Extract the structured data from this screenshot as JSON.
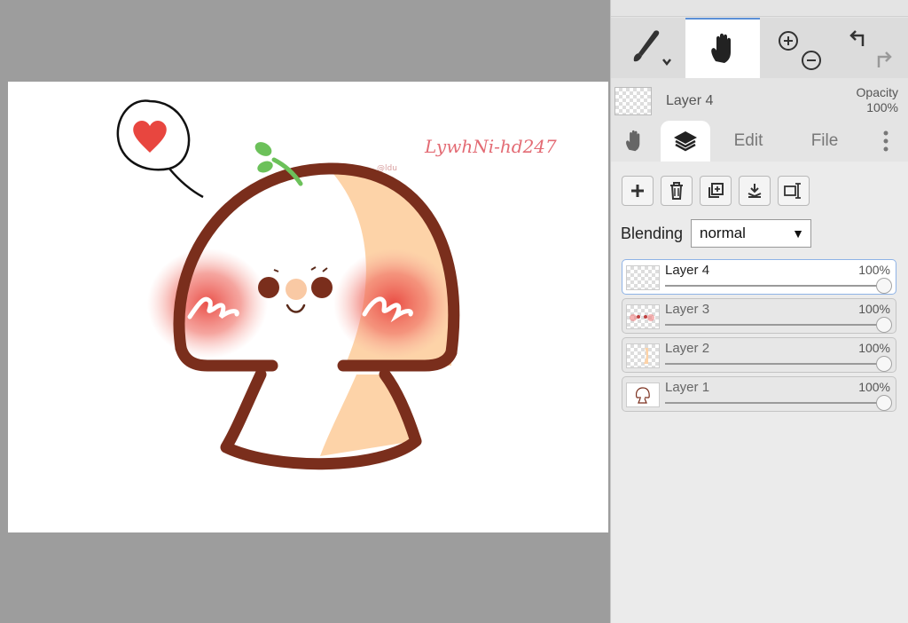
{
  "toolbar": {
    "tools": [
      "brush-icon",
      "hand-icon",
      "zoom-in-icon",
      "zoom-out-icon",
      "undo-icon",
      "redo-icon"
    ]
  },
  "current_layer": {
    "name": "Layer 4",
    "opacity_label": "Opacity",
    "opacity_value": "100%"
  },
  "tabs": {
    "edit": "Edit",
    "file": "File"
  },
  "blending": {
    "label": "Blending",
    "value": "normal"
  },
  "layers": [
    {
      "name": "Layer 4",
      "opacity": "100%"
    },
    {
      "name": "Layer 3",
      "opacity": "100%"
    },
    {
      "name": "Layer 2",
      "opacity": "100%"
    },
    {
      "name": "Layer 1",
      "opacity": "100%"
    }
  ],
  "canvas": {
    "signature": "LywhNi-hd247",
    "small_mark": "@ldu"
  },
  "colors": {
    "accent": "#5b8fd6",
    "outline": "#7a2e1c",
    "peach": "#fdd3a8",
    "blush": "#e8463f"
  }
}
